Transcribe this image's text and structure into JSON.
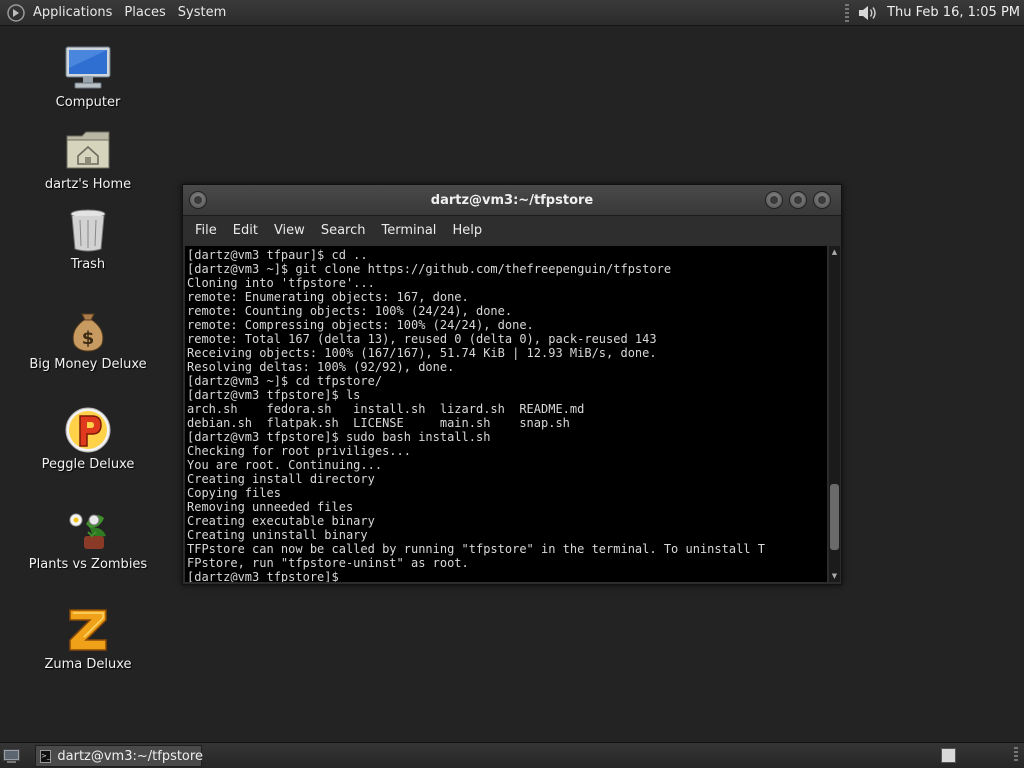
{
  "top_panel": {
    "menus": [
      "Applications",
      "Places",
      "System"
    ],
    "clock": "Thu Feb 16,  1:05 PM",
    "icons": {
      "logo": "gnome-foot-logo-icon",
      "volume": "speaker-volume-icon"
    }
  },
  "desktop": {
    "icons": [
      {
        "label": "Computer",
        "icon": "computer-monitor-icon"
      },
      {
        "label": "dartz's Home",
        "icon": "home-folder-icon"
      },
      {
        "label": "Trash",
        "icon": "trash-bin-icon"
      },
      {
        "label": "Big Money Deluxe",
        "icon": "money-bag-icon"
      },
      {
        "label": "Peggle Deluxe",
        "icon": "peggle-ball-icon"
      },
      {
        "label": "Plants vs Zombies",
        "icon": "plants-zombies-icon"
      },
      {
        "label": "Zuma Deluxe",
        "icon": "zuma-z-icon"
      }
    ]
  },
  "terminal": {
    "title": "dartz@vm3:~/tfpstore",
    "menus": [
      "File",
      "Edit",
      "View",
      "Search",
      "Terminal",
      "Help"
    ],
    "lines": [
      "[dartz@vm3 tfpaur]$ cd ..",
      "[dartz@vm3 ~]$ git clone https://github.com/thefreepenguin/tfpstore",
      "Cloning into 'tfpstore'...",
      "remote: Enumerating objects: 167, done.",
      "remote: Counting objects: 100% (24/24), done.",
      "remote: Compressing objects: 100% (24/24), done.",
      "remote: Total 167 (delta 13), reused 0 (delta 0), pack-reused 143",
      "Receiving objects: 100% (167/167), 51.74 KiB | 12.93 MiB/s, done.",
      "Resolving deltas: 100% (92/92), done.",
      "[dartz@vm3 ~]$ cd tfpstore/",
      "[dartz@vm3 tfpstore]$ ls",
      "arch.sh    fedora.sh   install.sh  lizard.sh  README.md",
      "debian.sh  flatpak.sh  LICENSE     main.sh    snap.sh",
      "[dartz@vm3 tfpstore]$ sudo bash install.sh",
      "Checking for root priviliges...",
      "You are root. Continuing...",
      "Creating install directory",
      "Copying files",
      "Removing unneeded files",
      "Creating executable binary",
      "Creating uninstall binary",
      "TFPstore can now be called by running \"tfpstore\" in the terminal. To uninstall T",
      "FPstore, run \"tfpstore-uninst\" as root.",
      "[dartz@vm3 tfpstore]$ "
    ],
    "scroll_position": 0.92
  },
  "bottom_panel": {
    "task": "dartz@vm3:~/tfpstore",
    "icons": {
      "show_desktop": "show-desktop-icon",
      "task": "terminal-icon",
      "workspace": "workspace-switcher-icon"
    }
  }
}
